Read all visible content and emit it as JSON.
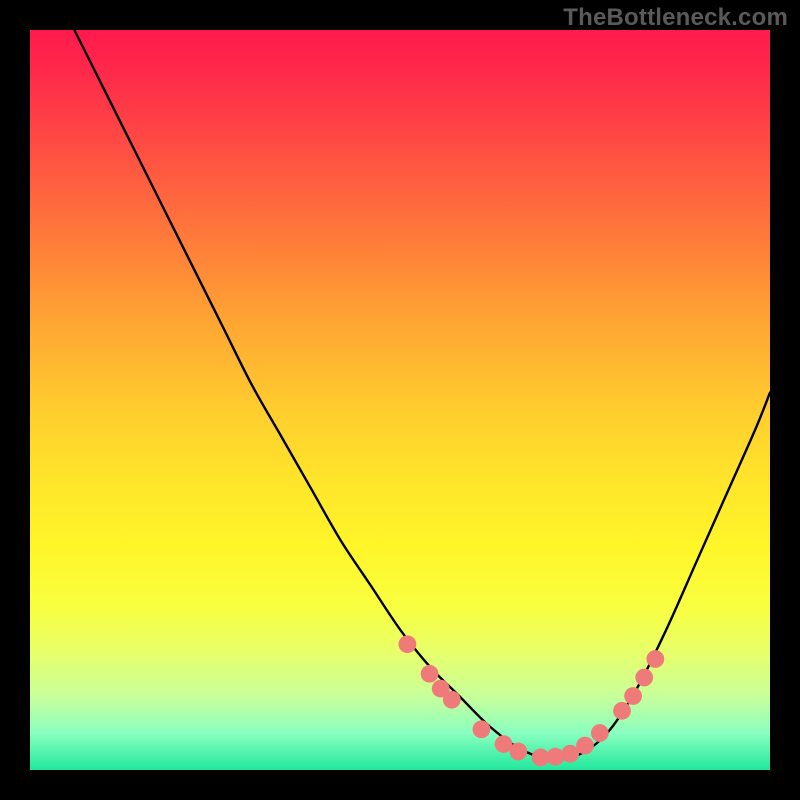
{
  "watermark": "TheBottleneck.com",
  "chart_data": {
    "type": "line",
    "title": "",
    "xlabel": "",
    "ylabel": "",
    "xlim": [
      0,
      100
    ],
    "ylim": [
      0,
      100
    ],
    "grid": false,
    "legend": false,
    "series": [
      {
        "name": "bottleneck-curve",
        "color": "#000000",
        "x": [
          6,
          10,
          14,
          18,
          22,
          26,
          30,
          34,
          38,
          42,
          46,
          50,
          54,
          58,
          62,
          66,
          70,
          74,
          78,
          82,
          86,
          90,
          94,
          98,
          100
        ],
        "y": [
          100,
          92,
          84,
          76,
          68,
          60,
          52,
          45,
          38,
          31,
          25,
          19,
          14,
          10,
          6,
          3,
          1.5,
          2,
          5,
          11,
          19,
          28,
          37,
          46,
          51
        ]
      }
    ],
    "markers": {
      "name": "highlight-points",
      "color": "#ef7a7a",
      "radius_pct": 1.2,
      "points": [
        {
          "x": 51,
          "y": 17
        },
        {
          "x": 54,
          "y": 13
        },
        {
          "x": 55.5,
          "y": 11
        },
        {
          "x": 57,
          "y": 9.5
        },
        {
          "x": 61,
          "y": 5.5
        },
        {
          "x": 64,
          "y": 3.5
        },
        {
          "x": 66,
          "y": 2.5
        },
        {
          "x": 69,
          "y": 1.7
        },
        {
          "x": 71,
          "y": 1.8
        },
        {
          "x": 73,
          "y": 2.2
        },
        {
          "x": 75,
          "y": 3.3
        },
        {
          "x": 77,
          "y": 5
        },
        {
          "x": 80,
          "y": 8
        },
        {
          "x": 81.5,
          "y": 10
        },
        {
          "x": 83,
          "y": 12.5
        },
        {
          "x": 84.5,
          "y": 15
        }
      ]
    }
  }
}
